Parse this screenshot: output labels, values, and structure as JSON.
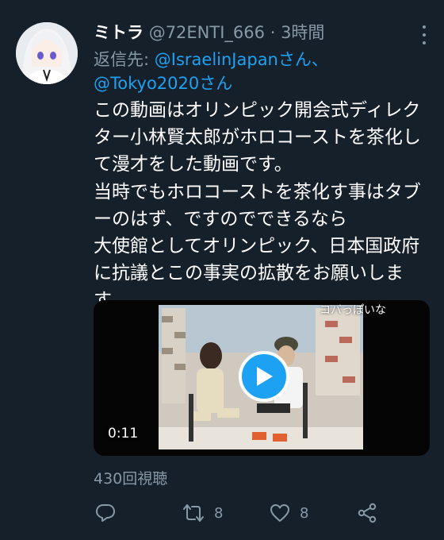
{
  "tweet": {
    "author_name": "ミトラ",
    "author_handle": "@72ENTI_666",
    "separator": "·",
    "time": "3時間",
    "reply_prefix": "返信先: ",
    "reply_mention_1": "@IsraelinJapan",
    "reply_joiner": "さん、",
    "reply_mention_2": "@Tokyo2020",
    "reply_suffix": "さん",
    "body_lines": [
      "この動画はオリンピック開会式ディレク",
      "ター小林賢太郎がホロコーストを茶化し",
      "て漫才をした動画です。",
      "当時でもホロコーストを茶化す事はタブ",
      "ーのはず、ですのでできるなら",
      "大使館としてオリンピック、日本国政府",
      "に抗議とこの事実の拡散をお願いしま",
      "す。"
    ]
  },
  "video": {
    "caption": "コバっぽいな",
    "duration": "0:11",
    "views": "430回視聴"
  },
  "actions": {
    "reply_icon": "comment-icon",
    "retweet_icon": "retweet-icon",
    "retweet_count": "8",
    "like_icon": "heart-icon",
    "like_count": "8",
    "share_icon": "share-icon"
  },
  "colors": {
    "background": "#15202b",
    "accent": "#1da1f2",
    "secondary_text": "#8899a6"
  }
}
